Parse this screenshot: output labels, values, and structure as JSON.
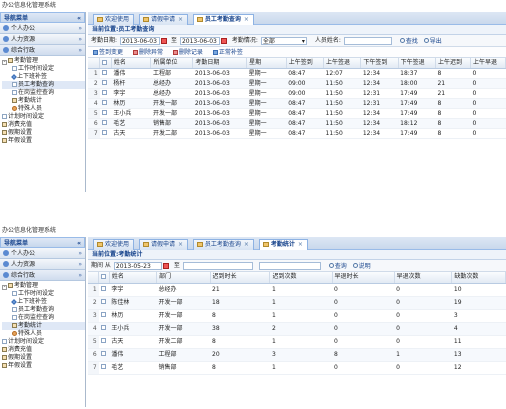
{
  "app_title": "办公信息化管理系统",
  "sidebar": {
    "header": "导航菜单",
    "sections": [
      {
        "label": "个人办公"
      },
      {
        "label": "人力资源"
      },
      {
        "label": "综合行政"
      }
    ],
    "tree": {
      "root": "考勤管理",
      "children": [
        "工作时间设定",
        "上下班补签",
        "员工考勤查询",
        "在岗监控查询",
        "考勤统计",
        "特殊人员"
      ],
      "siblings": [
        "计划时间设定",
        "消费充值",
        "假期设置",
        "年假设置"
      ]
    }
  },
  "window1": {
    "tabs": [
      {
        "label": "欢迎使用"
      },
      {
        "label": "请假申请"
      },
      {
        "label": "员工考勤查询"
      }
    ],
    "path": "当前位置:员工考勤查询",
    "filter": {
      "date_label": "考勤日期:",
      "date_from": "2013-06-03",
      "to_label": "至",
      "date_to": "2013-06-03",
      "status_label": "考勤情况:",
      "status_value": "全部",
      "person_label": "人员姓名:",
      "person_value": "",
      "search_label": "查找",
      "export_label": "导出"
    },
    "toolbar": [
      "签到变更",
      "删除异常",
      "删除记录",
      "正常补签"
    ],
    "columns": [
      "",
      "",
      "姓名",
      "所属单位",
      "考勤日期",
      "星期",
      "上午签到",
      "上午签退",
      "下午签到",
      "下午签退",
      "上午迟到",
      "上午早退"
    ],
    "rows": [
      [
        "1",
        "潘伟",
        "工程部",
        "2013-06-03",
        "星期一",
        "08:47",
        "12:07",
        "12:34",
        "18:37",
        "8",
        "0"
      ],
      [
        "2",
        "杨杆",
        "总经办",
        "2013-06-03",
        "星期一",
        "09:00",
        "11:50",
        "12:34",
        "18:00",
        "21",
        "0"
      ],
      [
        "3",
        "李宇",
        "总经办",
        "2013-06-03",
        "星期一",
        "09:00",
        "11:50",
        "12:31",
        "17:49",
        "21",
        "0"
      ],
      [
        "4",
        "林历",
        "开发一部",
        "2013-06-03",
        "星期一",
        "08:47",
        "11:50",
        "12:31",
        "17:49",
        "8",
        "0"
      ],
      [
        "5",
        "王小兵",
        "开发一部",
        "2013-06-03",
        "星期一",
        "08:47",
        "11:50",
        "12:34",
        "17:49",
        "8",
        "0"
      ],
      [
        "6",
        "毛艺",
        "销售部",
        "2013-06-03",
        "星期一",
        "08:47",
        "11:50",
        "12:34",
        "18:12",
        "8",
        "0"
      ],
      [
        "7",
        "古天",
        "开发二部",
        "2013-06-03",
        "星期一",
        "08:47",
        "11:50",
        "12:34",
        "17:49",
        "8",
        "0"
      ]
    ]
  },
  "window2": {
    "tabs": [
      {
        "label": "欢迎使用"
      },
      {
        "label": "请假申请"
      },
      {
        "label": "员工考勤查询"
      },
      {
        "label": "考勤统计"
      }
    ],
    "path": "当前位置:考勤统计",
    "filter": {
      "label": "期间 从",
      "date_from": "2013-05-23",
      "to_label": "至",
      "date_to": "",
      "extra": "",
      "search_label": "查询",
      "help_label": "说明"
    },
    "columns": [
      "",
      "",
      "姓名",
      "部门",
      "迟到时长",
      "迟到次数",
      "早退时长",
      "早退次数",
      "缺勤次数"
    ],
    "rows": [
      [
        "1",
        "李宇",
        "总经办",
        "21",
        "1",
        "0",
        "0",
        "10"
      ],
      [
        "2",
        "陈佳林",
        "开发一部",
        "18",
        "1",
        "0",
        "0",
        "19"
      ],
      [
        "3",
        "林历",
        "开发一部",
        "8",
        "1",
        "0",
        "0",
        "3"
      ],
      [
        "4",
        "王小兵",
        "开发一部",
        "38",
        "2",
        "0",
        "0",
        "4"
      ],
      [
        "5",
        "古天",
        "开发二部",
        "8",
        "1",
        "0",
        "0",
        "11"
      ],
      [
        "6",
        "潘伟",
        "工程部",
        "20",
        "3",
        "8",
        "1",
        "13"
      ],
      [
        "7",
        "毛艺",
        "销售部",
        "8",
        "1",
        "0",
        "0",
        "12"
      ]
    ]
  }
}
